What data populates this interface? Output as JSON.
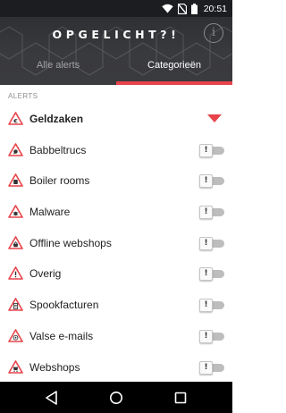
{
  "status_bar": {
    "time": "20:51",
    "icons": [
      "wifi-icon",
      "no-sim-icon",
      "battery-icon"
    ]
  },
  "header": {
    "title": "OPGELICHT?!",
    "info_label": "i",
    "tabs": [
      {
        "label": "Alle alerts",
        "active": false
      },
      {
        "label": "Categorieën",
        "active": true
      }
    ]
  },
  "section_label": "ALERTS",
  "categories": [
    {
      "label": "Geldzaken",
      "icon": "money-warning-icon",
      "expanded": true
    },
    {
      "label": "Babbeltrucs",
      "icon": "talk-warning-icon",
      "toggle": "!"
    },
    {
      "label": "Boiler rooms",
      "icon": "phone-warning-icon",
      "toggle": "!"
    },
    {
      "label": "Malware",
      "icon": "bug-warning-icon",
      "toggle": "!"
    },
    {
      "label": "Offline webshops",
      "icon": "shop-warning-icon",
      "toggle": "!"
    },
    {
      "label": "Overig",
      "icon": "exclamation-warning-icon",
      "toggle": "!"
    },
    {
      "label": "Spookfacturen",
      "icon": "invoice-warning-icon",
      "toggle": "!"
    },
    {
      "label": "Valse e-mails",
      "icon": "email-warning-icon",
      "toggle": "!"
    },
    {
      "label": "Webshops",
      "icon": "cart-warning-icon",
      "toggle": "!"
    }
  ],
  "colors": {
    "accent": "#e8444b",
    "header_bg": "#36373a",
    "nav_bg": "#000000"
  },
  "nav": [
    "back-icon",
    "home-icon",
    "recents-icon"
  ]
}
